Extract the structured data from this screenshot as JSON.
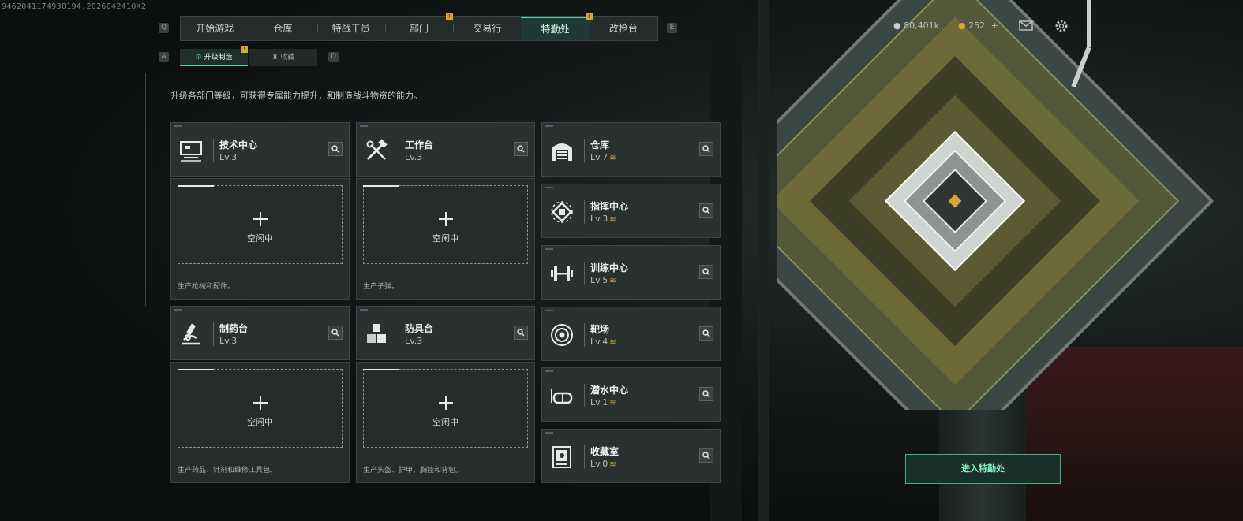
{
  "watermark": "9462041174930194,2026042410K2",
  "nav": {
    "key_left": "Q",
    "key_right": "E",
    "tabs": [
      {
        "label": "开始游戏",
        "badge": ""
      },
      {
        "label": "仓库",
        "badge": ""
      },
      {
        "label": "特战干员",
        "badge": ""
      },
      {
        "label": "部门",
        "badge": "!"
      },
      {
        "label": "交易行",
        "badge": ""
      },
      {
        "label": "特勤处",
        "badge": "!"
      },
      {
        "label": "改枪台",
        "badge": ""
      }
    ],
    "active_index": 5
  },
  "subnav": {
    "key_left": "A",
    "key_right": "D",
    "tabs": [
      {
        "label": "升级制造",
        "badge": "!"
      },
      {
        "label": "收藏",
        "badge": ""
      }
    ]
  },
  "description": "升级各部门等级，可获得专属能力提升，和制造战斗物资的能力。",
  "production_cards": [
    {
      "title": "技术中心",
      "level": "Lv.3",
      "slot_label": "空闲中",
      "desc": "生产枪械和配件。",
      "icon": "monitor-icon"
    },
    {
      "title": "工作台",
      "level": "Lv.3",
      "slot_label": "空闲中",
      "desc": "生产子弹。",
      "icon": "tools-icon"
    },
    {
      "title": "制药台",
      "level": "Lv.3",
      "slot_label": "空闲中",
      "desc": "生产药品、针剂和维修工具包。",
      "icon": "microscope-icon"
    },
    {
      "title": "防具台",
      "level": "Lv.3",
      "slot_label": "空闲中",
      "desc": "生产头盔、护甲、胸挂和背包。",
      "icon": "cubes-icon"
    }
  ],
  "facility_cards": [
    {
      "title": "仓库",
      "level": "Lv.7",
      "upgrade": "≋",
      "icon": "warehouse-icon"
    },
    {
      "title": "指挥中心",
      "level": "Lv.3",
      "upgrade": "≋",
      "icon": "chip-icon"
    },
    {
      "title": "训练中心",
      "level": "Lv.5",
      "upgrade": "≋",
      "icon": "dumbbell-icon"
    },
    {
      "title": "靶场",
      "level": "Lv.4",
      "upgrade": "≋",
      "icon": "target-icon"
    },
    {
      "title": "潜水中心",
      "level": "Lv.1",
      "upgrade": "≋",
      "icon": "goggles-icon"
    },
    {
      "title": "收藏室",
      "level": "Lv.0",
      "upgrade": "≋",
      "icon": "vault-icon"
    }
  ],
  "resources": {
    "currency": "80,401k",
    "tokens": "252",
    "tokens_add": "+"
  },
  "enter_button": "进入特勤处",
  "colors": {
    "accent": "#4fd6a2",
    "badge": "#d9a636",
    "upgrade": "#d9a636"
  }
}
